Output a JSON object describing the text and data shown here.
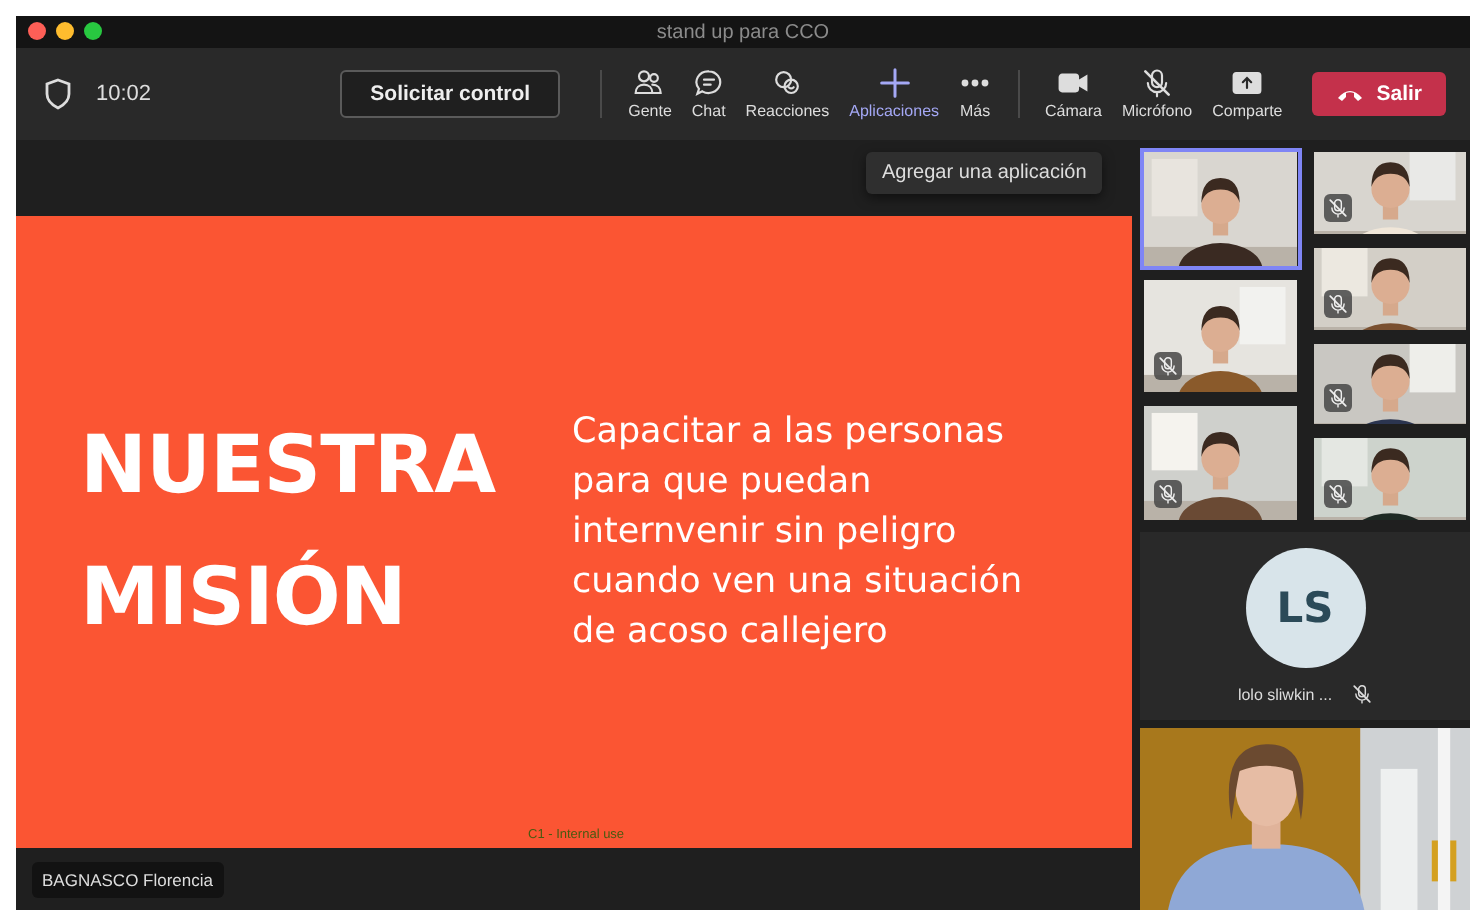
{
  "window": {
    "title": "stand up para CCO"
  },
  "toolbar": {
    "time": "10:02",
    "request_button": "Solicitar control",
    "items": [
      {
        "kind": "people",
        "label": "Gente",
        "active": false
      },
      {
        "kind": "chat",
        "label": "Chat",
        "active": false
      },
      {
        "kind": "reactions",
        "label": "Reacciones",
        "active": false
      },
      {
        "kind": "apps",
        "label": "Aplicaciones",
        "active": true
      },
      {
        "kind": "more",
        "label": "Más",
        "active": false
      }
    ],
    "devices": [
      {
        "kind": "camera",
        "label": "Cámara",
        "off": false
      },
      {
        "kind": "mic",
        "label": "Micrófono",
        "off": true
      },
      {
        "kind": "share",
        "label": "Comparte",
        "off": false
      }
    ],
    "leave_button": "Salir"
  },
  "tooltip": "Agregar una aplicación",
  "slide": {
    "heading": "NUESTRA MISIÓN",
    "body": "Capacitar a las personas para que puedan internvenir sin peligro cuando ven una situación de acoso callejero",
    "footer": "C1 - Internal use"
  },
  "presenter": "BAGNASCO Florencia",
  "participants": {
    "columns": [
      {
        "tiles": [
          {
            "selected": true,
            "muted": false
          },
          {
            "selected": false,
            "muted": true
          },
          {
            "selected": false,
            "muted": true
          }
        ]
      },
      {
        "tiles": [
          {
            "selected": false,
            "muted": true
          },
          {
            "selected": false,
            "muted": true
          },
          {
            "selected": false,
            "muted": true
          },
          {
            "selected": false,
            "muted": true
          }
        ]
      }
    ],
    "avatar": {
      "initials": "LS",
      "name": "lolo sliwkin ...",
      "muted": true
    }
  }
}
